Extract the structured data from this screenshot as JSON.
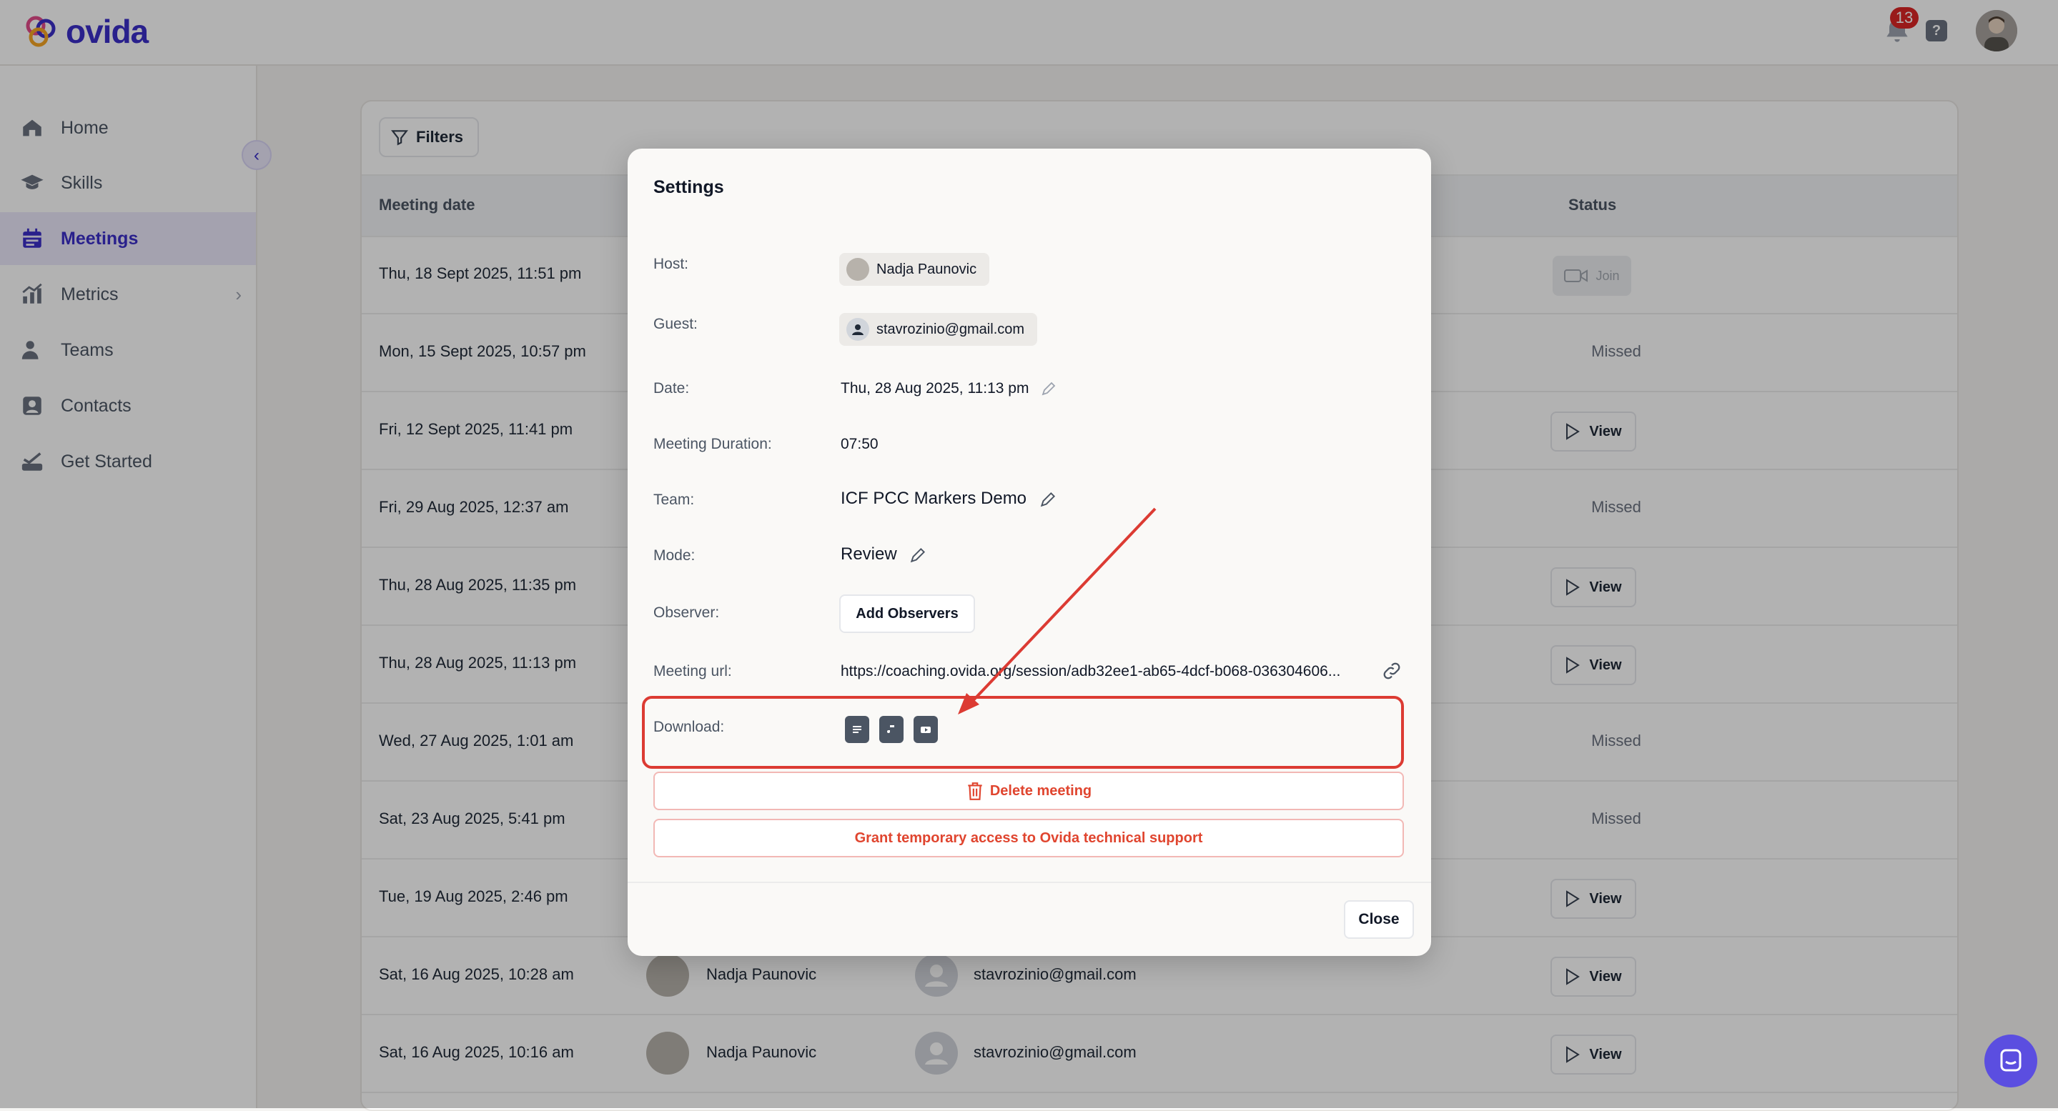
{
  "app": {
    "logo_text": "ovida",
    "brand_color": "#3b2fc9"
  },
  "topbar": {
    "notification_count": "13",
    "help_label": "?"
  },
  "sidebar": {
    "items": [
      {
        "label": "Home",
        "icon": "home-icon"
      },
      {
        "label": "Skills",
        "icon": "graduation-cap-icon"
      },
      {
        "label": "Meetings",
        "icon": "calendar-icon",
        "active": true
      },
      {
        "label": "Metrics",
        "icon": "chart-icon",
        "has_submenu": true
      },
      {
        "label": "Teams",
        "icon": "users-icon"
      },
      {
        "label": "Contacts",
        "icon": "contact-card-icon"
      },
      {
        "label": "Get Started",
        "icon": "checklist-icon"
      }
    ]
  },
  "table": {
    "filters_label": "Filters",
    "headers": {
      "meeting_date": "Meeting date",
      "status": "Status"
    },
    "rows": [
      {
        "date": "Thu, 18 Sept 2025, 11:51 pm",
        "status": "Join"
      },
      {
        "date": "Mon, 15 Sept 2025, 10:57 pm",
        "status": "Missed"
      },
      {
        "date": "Fri, 12 Sept 2025, 11:41 pm",
        "status": "View"
      },
      {
        "date": "Fri, 29 Aug 2025, 12:37 am",
        "status": "Missed"
      },
      {
        "date": "Thu, 28 Aug 2025, 11:35 pm",
        "status": "View"
      },
      {
        "date": "Thu, 28 Aug 2025, 11:13 pm",
        "status": "View"
      },
      {
        "date": "Wed, 27 Aug 2025, 1:01 am",
        "status": "Missed"
      },
      {
        "date": "Sat, 23 Aug 2025, 5:41 pm",
        "status": "Missed"
      },
      {
        "date": "Tue, 19 Aug 2025, 2:46 pm",
        "status": "View"
      },
      {
        "date": "Sat, 16 Aug 2025, 10:28 am",
        "host": "Nadja Paunovic",
        "guest": "stavrozinio@gmail.com",
        "status": "View"
      },
      {
        "date": "Sat, 16 Aug 2025, 10:16 am",
        "host": "Nadja Paunovic",
        "guest": "stavrozinio@gmail.com",
        "status": "View"
      }
    ]
  },
  "modal": {
    "title": "Settings",
    "host_label": "Host:",
    "host_name": "Nadja Paunovic",
    "guest_label": "Guest:",
    "guest_email": "stavrozinio@gmail.com",
    "date_label": "Date:",
    "date_value": "Thu, 28 Aug 2025, 11:13 pm",
    "duration_label": "Meeting Duration:",
    "duration_value": "07:50",
    "team_label": "Team:",
    "team_value": "ICF PCC Markers Demo",
    "mode_label": "Mode:",
    "mode_value": "Review",
    "observer_label": "Observer:",
    "add_observers_label": "Add Observers",
    "url_label": "Meeting url:",
    "url_value": "https://coaching.ovida.org/session/adb32ee1-ab65-4dcf-b068-036304606...",
    "download_label": "Download:",
    "download_icons": [
      "transcript-file-icon",
      "audio-file-icon",
      "video-file-icon"
    ],
    "delete_label": "Delete meeting",
    "grant_label": "Grant temporary access to Ovida technical support",
    "close_label": "Close",
    "danger_color": "#e0452f",
    "annotation_color": "#dc3b33"
  }
}
